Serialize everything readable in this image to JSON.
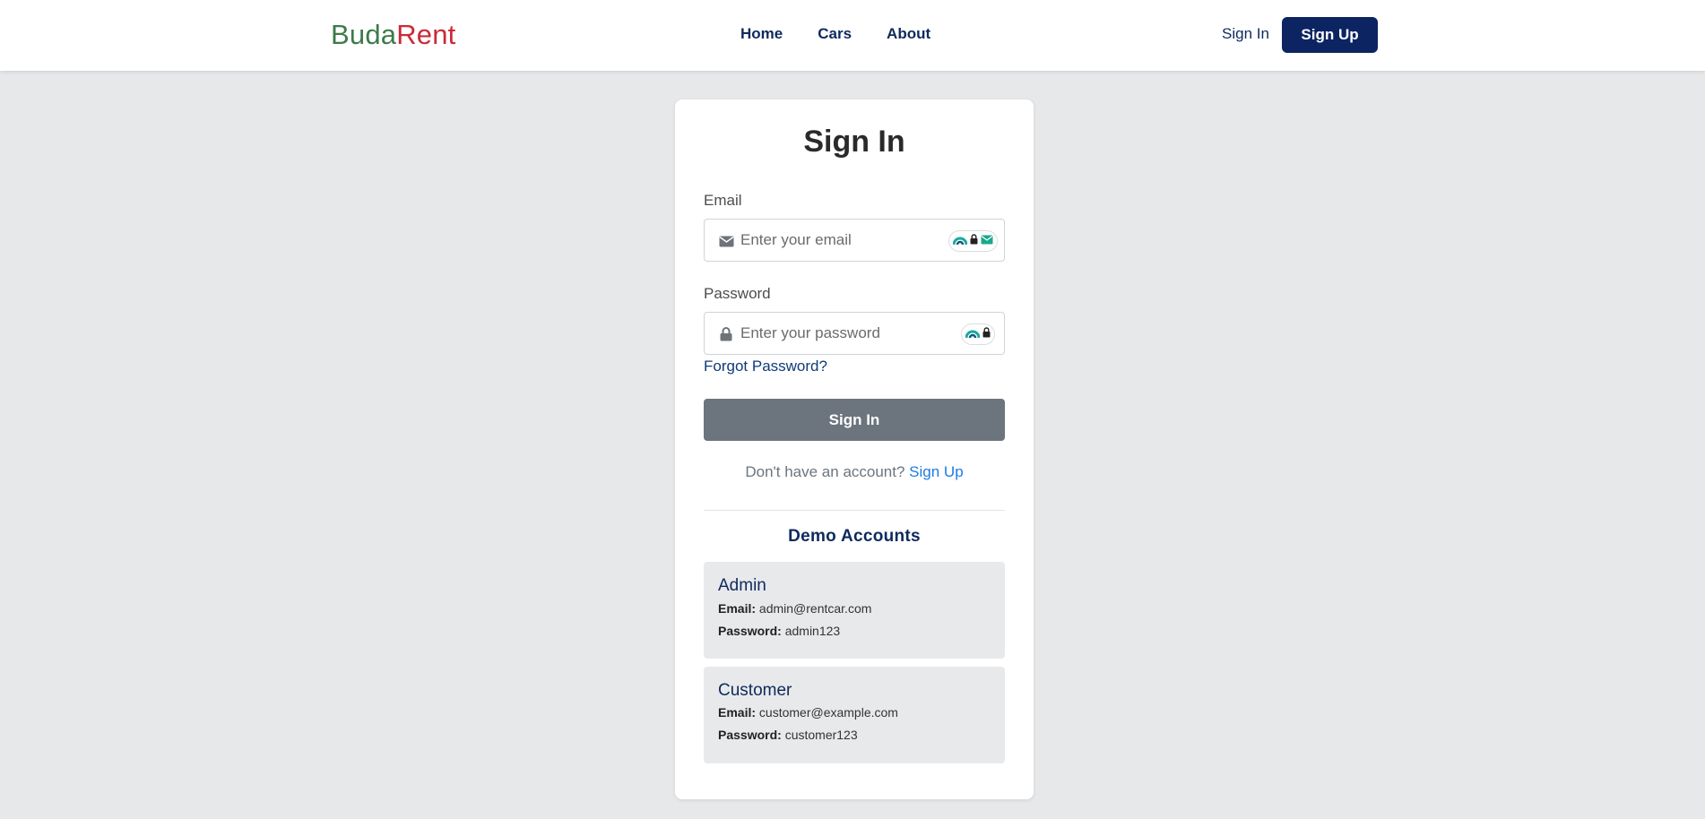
{
  "header": {
    "brand_part1": "Buda",
    "brand_part2": "Rent",
    "nav": [
      "Home",
      "Cars",
      "About"
    ],
    "sign_in": "Sign In",
    "sign_up": "Sign Up"
  },
  "form": {
    "title": "Sign In",
    "email_label": "Email",
    "email_placeholder": "Enter your email",
    "password_label": "Password",
    "password_placeholder": "Enter your password",
    "forgot": "Forgot Password?",
    "submit": "Sign In",
    "register_prompt": "Don't have an account?",
    "register_link": "Sign Up"
  },
  "demo": {
    "heading": "Demo Accounts",
    "email_key": "Email:",
    "password_key": "Password:",
    "accounts": [
      {
        "role": "Admin",
        "email": "admin@rentcar.com",
        "password": "admin123"
      },
      {
        "role": "Customer",
        "email": "customer@example.com",
        "password": "customer123"
      }
    ]
  },
  "colors": {
    "brand_green": "#3d7a4a",
    "brand_red": "#cc2a36",
    "navy": "#0c2461",
    "submit_gray": "#6c757d",
    "link_blue": "#1e7be6"
  },
  "icons": [
    "envelope-icon",
    "lock-icon",
    "password-manager-icon"
  ]
}
